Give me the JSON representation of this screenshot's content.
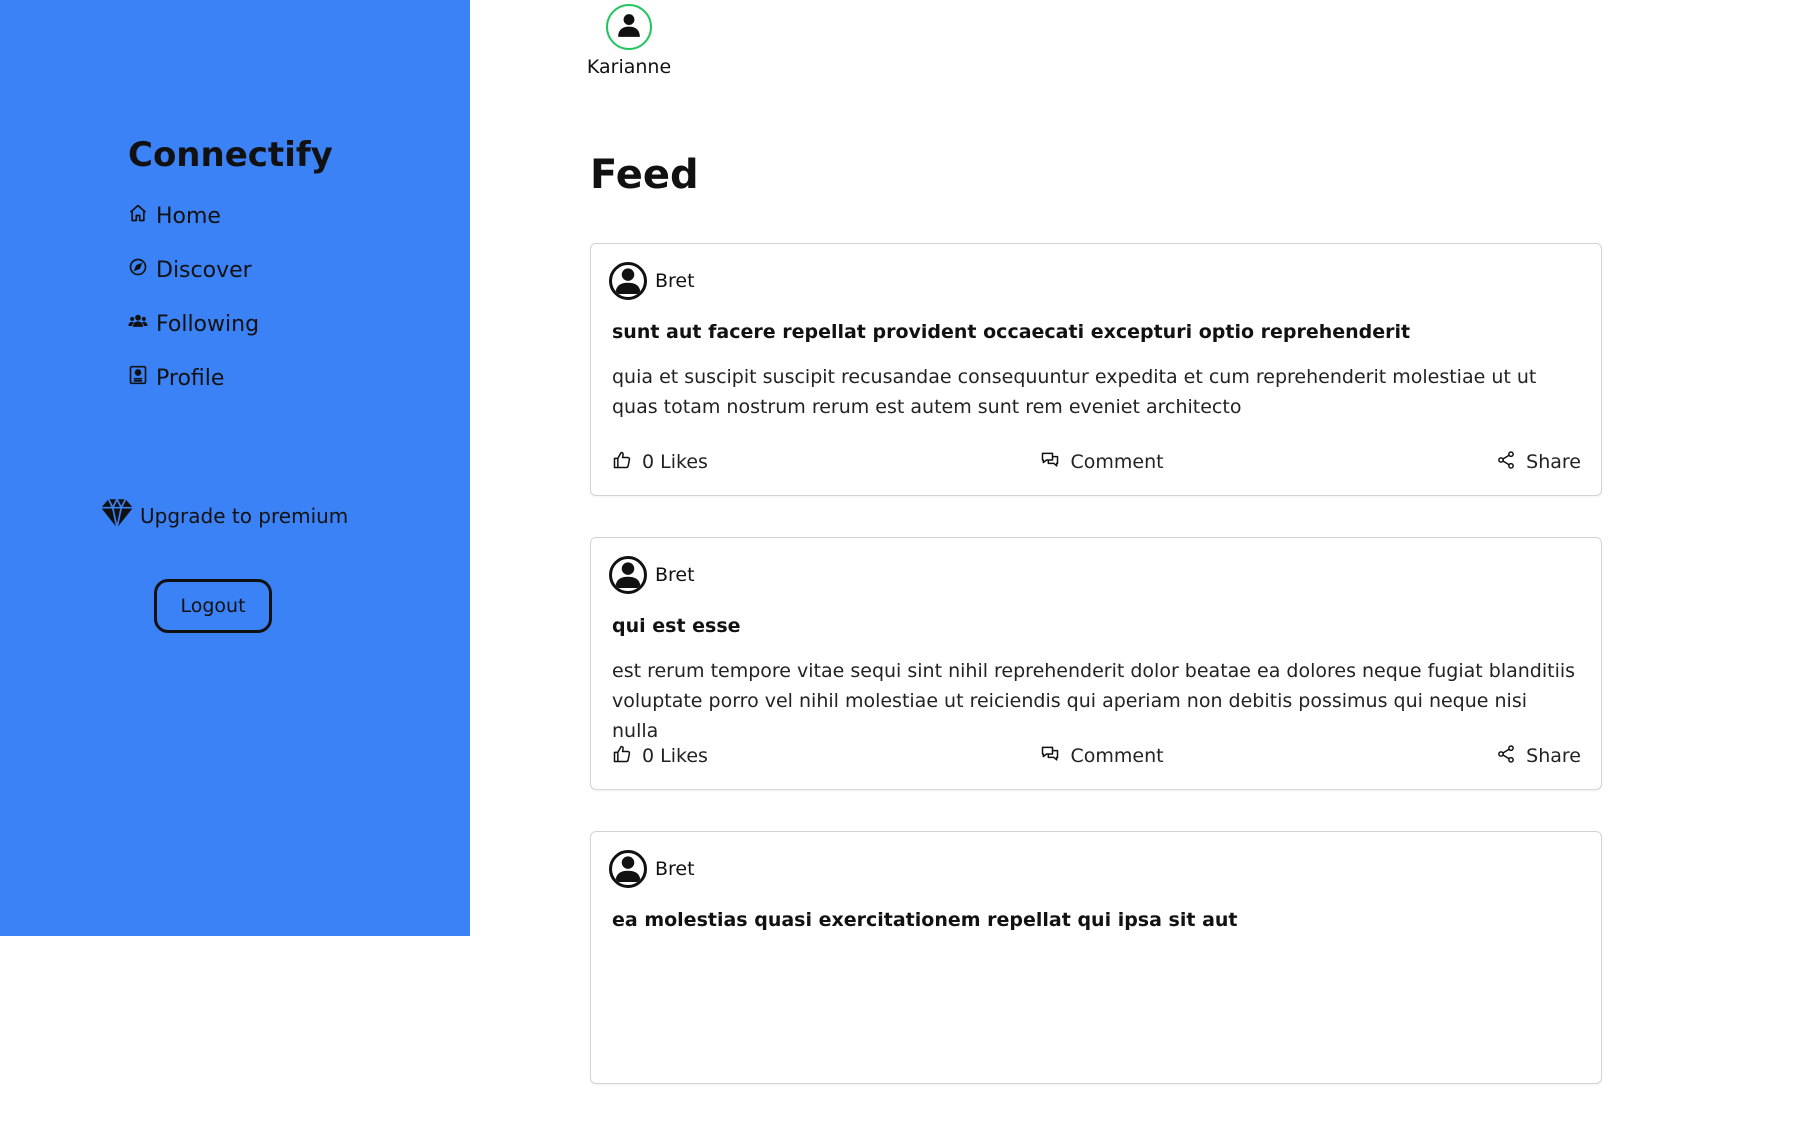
{
  "sidebar": {
    "brand": "Connectify",
    "nav": [
      {
        "label": "Home",
        "icon": "home-icon"
      },
      {
        "label": "Discover",
        "icon": "compass-icon"
      },
      {
        "label": "Following",
        "icon": "users-icon"
      },
      {
        "label": "Profile",
        "icon": "profile-card-icon"
      }
    ],
    "upgrade_label": "Upgrade to premium",
    "upgrade_icon": "diamond-icon",
    "logout_label": "Logout",
    "background_color": "#3b82f6"
  },
  "stories": [
    {
      "name": "Karianne",
      "ring_color": "#22c55e",
      "icon": "user-icon"
    }
  ],
  "feed": {
    "title": "Feed",
    "posts": [
      {
        "author": "Bret",
        "title": "sunt aut facere repellat provident occaecati excepturi optio reprehenderit",
        "body": "quia et suscipit suscipit recusandae consequuntur expedita et cum reprehenderit molestiae ut ut quas totam nostrum rerum est autem sunt rem eveniet architecto",
        "likes_label": "0 Likes",
        "comment_label": "Comment",
        "share_label": "Share"
      },
      {
        "author": "Bret",
        "title": "qui est esse",
        "body": "est rerum tempore vitae sequi sint nihil reprehenderit dolor beatae ea dolores neque fugiat blanditiis voluptate porro vel nihil molestiae ut reiciendis qui aperiam non debitis possimus qui neque nisi nulla",
        "likes_label": "0 Likes",
        "comment_label": "Comment",
        "share_label": "Share"
      },
      {
        "author": "Bret",
        "title": "ea molestias quasi exercitationem repellat qui ipsa sit aut",
        "body": "",
        "likes_label": "",
        "comment_label": "",
        "share_label": ""
      }
    ]
  }
}
